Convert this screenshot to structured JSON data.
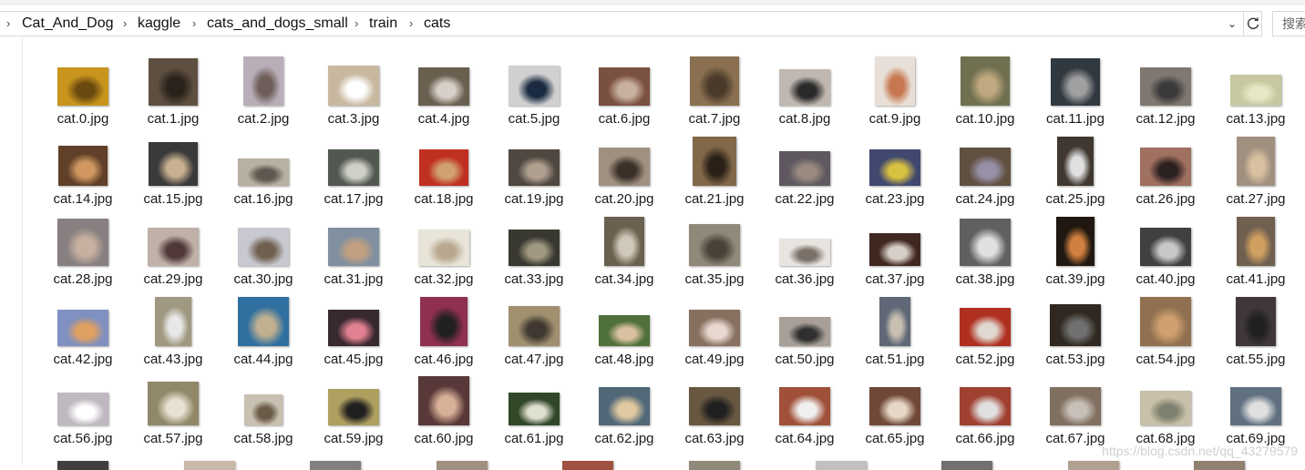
{
  "address_bar": {
    "path": [
      "Cat_And_Dog",
      "kaggle",
      "cats_and_dogs_small",
      "train",
      "cats"
    ],
    "search_placeholder": "搜索"
  },
  "icons": {
    "chevron": "chevron-right-icon",
    "dropdown": "chevron-down-icon",
    "refresh": "refresh-icon"
  },
  "files": [
    {
      "name": "cat.0.jpg",
      "thumb": {
        "bg": "#c8941c",
        "accent": "#6b4a10",
        "w": 56,
        "h": 42
      }
    },
    {
      "name": "cat.1.jpg",
      "thumb": {
        "bg": "#5e5040",
        "accent": "#2a221a",
        "w": 54,
        "h": 52
      }
    },
    {
      "name": "cat.2.jpg",
      "thumb": {
        "bg": "#b9aeb8",
        "accent": "#6e5e5a",
        "w": 44,
        "h": 54
      }
    },
    {
      "name": "cat.3.jpg",
      "thumb": {
        "bg": "#c8b8a0",
        "accent": "#ffffff",
        "w": 56,
        "h": 44
      }
    },
    {
      "name": "cat.4.jpg",
      "thumb": {
        "bg": "#6a6050",
        "accent": "#d8d0c8",
        "w": 56,
        "h": 42
      }
    },
    {
      "name": "cat.5.jpg",
      "thumb": {
        "bg": "#d0d0d0",
        "accent": "#1a2a40",
        "w": 56,
        "h": 44
      }
    },
    {
      "name": "cat.6.jpg",
      "thumb": {
        "bg": "#7a5040",
        "accent": "#c8b0a0",
        "w": 56,
        "h": 42
      }
    },
    {
      "name": "cat.7.jpg",
      "thumb": {
        "bg": "#8a7050",
        "accent": "#4a3a2a",
        "w": 54,
        "h": 54
      }
    },
    {
      "name": "cat.8.jpg",
      "thumb": {
        "bg": "#c0b8b0",
        "accent": "#2a2a2a",
        "w": 56,
        "h": 40
      }
    },
    {
      "name": "cat.9.jpg",
      "thumb": {
        "bg": "#e8e0d8",
        "accent": "#c87850",
        "w": 44,
        "h": 54
      }
    },
    {
      "name": "cat.10.jpg",
      "thumb": {
        "bg": "#707050",
        "accent": "#c0a880",
        "w": 54,
        "h": 54
      }
    },
    {
      "name": "cat.11.jpg",
      "thumb": {
        "bg": "#303840",
        "accent": "#a0a0a0",
        "w": 54,
        "h": 52
      }
    },
    {
      "name": "cat.12.jpg",
      "thumb": {
        "bg": "#807870",
        "accent": "#3a3a3a",
        "w": 56,
        "h": 42
      }
    },
    {
      "name": "cat.13.jpg",
      "thumb": {
        "bg": "#c8c8a0",
        "accent": "#e8e8c8",
        "w": 56,
        "h": 34
      }
    },
    {
      "name": "cat.14.jpg",
      "thumb": {
        "bg": "#604028",
        "accent": "#d09860",
        "w": 54,
        "h": 44
      }
    },
    {
      "name": "cat.15.jpg",
      "thumb": {
        "bg": "#3a3a3a",
        "accent": "#c8b090",
        "w": 54,
        "h": 48
      }
    },
    {
      "name": "cat.16.jpg",
      "thumb": {
        "bg": "#b8b0a0",
        "accent": "#605850",
        "w": 56,
        "h": 30
      }
    },
    {
      "name": "cat.17.jpg",
      "thumb": {
        "bg": "#505850",
        "accent": "#d0d0c8",
        "w": 56,
        "h": 40
      }
    },
    {
      "name": "cat.18.jpg",
      "thumb": {
        "bg": "#c03020",
        "accent": "#d0a070",
        "w": 54,
        "h": 40
      }
    },
    {
      "name": "cat.19.jpg",
      "thumb": {
        "bg": "#504840",
        "accent": "#b0a090",
        "w": 56,
        "h": 40
      }
    },
    {
      "name": "cat.20.jpg",
      "thumb": {
        "bg": "#a09080",
        "accent": "#3a3028",
        "w": 56,
        "h": 42
      }
    },
    {
      "name": "cat.21.jpg",
      "thumb": {
        "bg": "#806848",
        "accent": "#2a2018",
        "w": 48,
        "h": 54
      }
    },
    {
      "name": "cat.22.jpg",
      "thumb": {
        "bg": "#605860",
        "accent": "#9a8a80",
        "w": 56,
        "h": 38
      }
    },
    {
      "name": "cat.23.jpg",
      "thumb": {
        "bg": "#404870",
        "accent": "#d8c040",
        "w": 56,
        "h": 40
      }
    },
    {
      "name": "cat.24.jpg",
      "thumb": {
        "bg": "#605040",
        "accent": "#9890a8",
        "w": 56,
        "h": 42
      }
    },
    {
      "name": "cat.25.jpg",
      "thumb": {
        "bg": "#403830",
        "accent": "#e0e0e0",
        "w": 40,
        "h": 54
      }
    },
    {
      "name": "cat.26.jpg",
      "thumb": {
        "bg": "#a07060",
        "accent": "#2a2020",
        "w": 56,
        "h": 42
      }
    },
    {
      "name": "cat.27.jpg",
      "thumb": {
        "bg": "#a09080",
        "accent": "#d8c0a0",
        "w": 42,
        "h": 54
      }
    },
    {
      "name": "cat.28.jpg",
      "thumb": {
        "bg": "#888080",
        "accent": "#c8b0a0",
        "w": 56,
        "h": 52
      }
    },
    {
      "name": "cat.29.jpg",
      "thumb": {
        "bg": "#c0b0a8",
        "accent": "#503838",
        "w": 56,
        "h": 42
      }
    },
    {
      "name": "cat.30.jpg",
      "thumb": {
        "bg": "#c8c8d0",
        "accent": "#706050",
        "w": 56,
        "h": 42
      }
    },
    {
      "name": "cat.31.jpg",
      "thumb": {
        "bg": "#8090a0",
        "accent": "#c0a080",
        "w": 56,
        "h": 42
      }
    },
    {
      "name": "cat.32.jpg",
      "thumb": {
        "bg": "#e8e4d8",
        "accent": "#b8a890",
        "w": 56,
        "h": 40
      }
    },
    {
      "name": "cat.33.jpg",
      "thumb": {
        "bg": "#383830",
        "accent": "#a09880",
        "w": 56,
        "h": 40
      }
    },
    {
      "name": "cat.34.jpg",
      "thumb": {
        "bg": "#6a6050",
        "accent": "#d0c8b8",
        "w": 44,
        "h": 54
      }
    },
    {
      "name": "cat.35.jpg",
      "thumb": {
        "bg": "#908878",
        "accent": "#4a4238",
        "w": 56,
        "h": 46
      }
    },
    {
      "name": "cat.36.jpg",
      "thumb": {
        "bg": "#e8e4e0",
        "accent": "#7a7068",
        "w": 56,
        "h": 30
      }
    },
    {
      "name": "cat.37.jpg",
      "thumb": {
        "bg": "#402820",
        "accent": "#d8d0c8",
        "w": 56,
        "h": 36
      }
    },
    {
      "name": "cat.38.jpg",
      "thumb": {
        "bg": "#606060",
        "accent": "#e0e0e0",
        "w": 56,
        "h": 52
      }
    },
    {
      "name": "cat.39.jpg",
      "thumb": {
        "bg": "#201810",
        "accent": "#d08040",
        "w": 42,
        "h": 54
      }
    },
    {
      "name": "cat.40.jpg",
      "thumb": {
        "bg": "#404040",
        "accent": "#c8c8c8",
        "w": 56,
        "h": 42
      }
    },
    {
      "name": "cat.41.jpg",
      "thumb": {
        "bg": "#706050",
        "accent": "#d0a060",
        "w": 42,
        "h": 54
      }
    },
    {
      "name": "cat.42.jpg",
      "thumb": {
        "bg": "#8090c0",
        "accent": "#e0a060",
        "w": 56,
        "h": 40
      }
    },
    {
      "name": "cat.43.jpg",
      "thumb": {
        "bg": "#a09880",
        "accent": "#e8e8e8",
        "w": 40,
        "h": 54
      }
    },
    {
      "name": "cat.44.jpg",
      "thumb": {
        "bg": "#3070a0",
        "accent": "#c0b090",
        "w": 56,
        "h": 54
      }
    },
    {
      "name": "cat.45.jpg",
      "thumb": {
        "bg": "#382830",
        "accent": "#e08090",
        "w": 56,
        "h": 40
      }
    },
    {
      "name": "cat.46.jpg",
      "thumb": {
        "bg": "#903050",
        "accent": "#202020",
        "w": 52,
        "h": 54
      }
    },
    {
      "name": "cat.47.jpg",
      "thumb": {
        "bg": "#a09070",
        "accent": "#403830",
        "w": 56,
        "h": 44
      }
    },
    {
      "name": "cat.48.jpg",
      "thumb": {
        "bg": "#50703a",
        "accent": "#d8c0a0",
        "w": 56,
        "h": 34
      }
    },
    {
      "name": "cat.49.jpg",
      "thumb": {
        "bg": "#887060",
        "accent": "#e8d8d0",
        "w": 56,
        "h": 40
      }
    },
    {
      "name": "cat.50.jpg",
      "thumb": {
        "bg": "#a8a098",
        "accent": "#303030",
        "w": 56,
        "h": 32
      }
    },
    {
      "name": "cat.51.jpg",
      "thumb": {
        "bg": "#606878",
        "accent": "#c8c0b0",
        "w": 34,
        "h": 54
      }
    },
    {
      "name": "cat.52.jpg",
      "thumb": {
        "bg": "#b03020",
        "accent": "#e0d8d0",
        "w": 56,
        "h": 42
      }
    },
    {
      "name": "cat.53.jpg",
      "thumb": {
        "bg": "#302820",
        "accent": "#707070",
        "w": 56,
        "h": 46
      }
    },
    {
      "name": "cat.54.jpg",
      "thumb": {
        "bg": "#907050",
        "accent": "#d0a070",
        "w": 56,
        "h": 54
      }
    },
    {
      "name": "cat.55.jpg",
      "thumb": {
        "bg": "#403838",
        "accent": "#202020",
        "w": 44,
        "h": 54
      }
    },
    {
      "name": "cat.56.jpg",
      "thumb": {
        "bg": "#c0b8c0",
        "accent": "#ffffff",
        "w": 56,
        "h": 36
      }
    },
    {
      "name": "cat.57.jpg",
      "thumb": {
        "bg": "#908868",
        "accent": "#e8e0d0",
        "w": 56,
        "h": 48
      }
    },
    {
      "name": "cat.58.jpg",
      "thumb": {
        "bg": "#c8c0b0",
        "accent": "#6a5a48",
        "w": 42,
        "h": 34
      }
    },
    {
      "name": "cat.59.jpg",
      "thumb": {
        "bg": "#b0a060",
        "accent": "#202020",
        "w": 56,
        "h": 40
      }
    },
    {
      "name": "cat.60.jpg",
      "thumb": {
        "bg": "#583838",
        "accent": "#d8b098",
        "w": 56,
        "h": 54
      }
    },
    {
      "name": "cat.61.jpg",
      "thumb": {
        "bg": "#304828",
        "accent": "#e0e0d0",
        "w": 56,
        "h": 36
      }
    },
    {
      "name": "cat.62.jpg",
      "thumb": {
        "bg": "#506878",
        "accent": "#e0c8a0",
        "w": 56,
        "h": 42
      }
    },
    {
      "name": "cat.63.jpg",
      "thumb": {
        "bg": "#685840",
        "accent": "#202020",
        "w": 56,
        "h": 42
      }
    },
    {
      "name": "cat.64.jpg",
      "thumb": {
        "bg": "#a05038",
        "accent": "#f0f0f0",
        "w": 56,
        "h": 42
      }
    },
    {
      "name": "cat.65.jpg",
      "thumb": {
        "bg": "#704838",
        "accent": "#e8d8c8",
        "w": 56,
        "h": 42
      }
    },
    {
      "name": "cat.66.jpg",
      "thumb": {
        "bg": "#a04030",
        "accent": "#e0e0e0",
        "w": 56,
        "h": 42
      }
    },
    {
      "name": "cat.67.jpg",
      "thumb": {
        "bg": "#807060",
        "accent": "#c8c0b8",
        "w": 56,
        "h": 42
      }
    },
    {
      "name": "cat.68.jpg",
      "thumb": {
        "bg": "#c8c0a8",
        "accent": "#808070",
        "w": 56,
        "h": 38
      }
    },
    {
      "name": "cat.69.jpg",
      "thumb": {
        "bg": "#607080",
        "accent": "#e0e0e0",
        "w": 56,
        "h": 42
      }
    }
  ],
  "partial_row": [
    {
      "bg": "#404040"
    },
    {
      "bg": "#c8b8a8"
    },
    {
      "bg": "#808080"
    },
    {
      "bg": "#a09080"
    },
    {
      "bg": "#a05040"
    },
    {
      "bg": "#908878"
    },
    {
      "bg": "#c0c0c0"
    },
    {
      "bg": "#707070"
    },
    {
      "bg": "#b0a090"
    },
    {
      "bg": "#908070"
    }
  ],
  "watermark": "https://blog.csdn.net/qq_43279579"
}
